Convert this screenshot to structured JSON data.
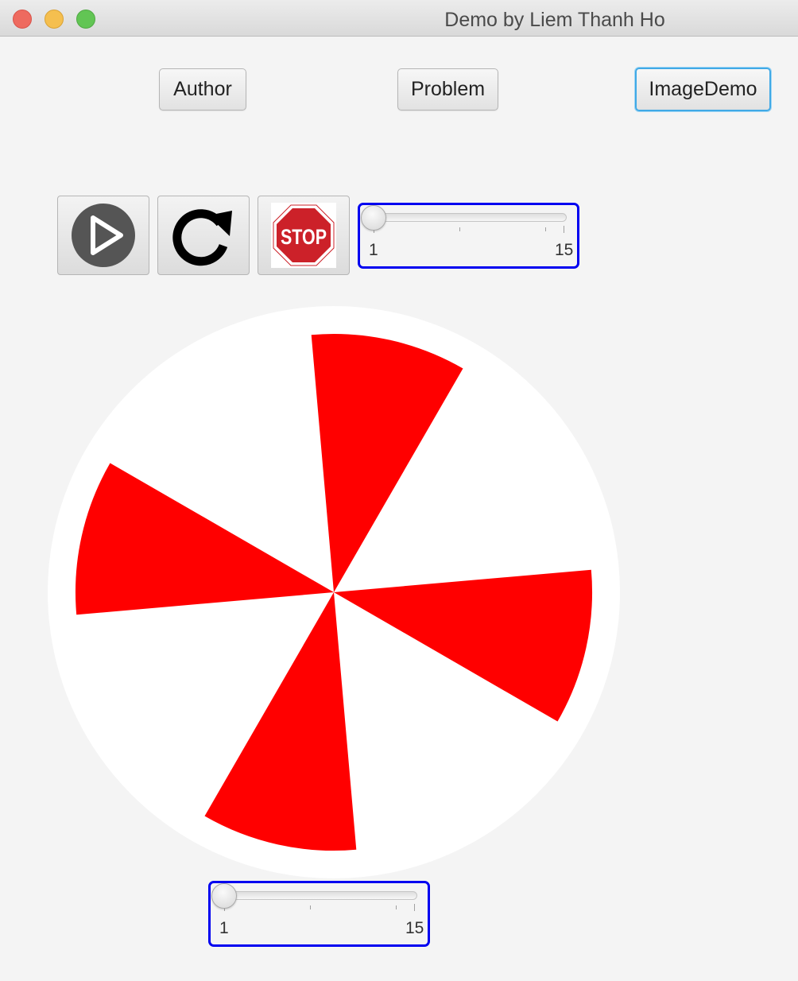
{
  "window": {
    "title": "Demo by Liem Thanh Ho"
  },
  "nav": {
    "author_label": "Author",
    "problem_label": "Problem",
    "imagedemo_label": "ImageDemo"
  },
  "controls": {
    "play_icon": "play-icon",
    "replay_icon": "replay-icon",
    "stop_icon": "stop-sign-icon",
    "stop_text": "STOP"
  },
  "top_slider": {
    "min": 1,
    "max": 15,
    "value": 1,
    "min_label": "1",
    "max_label": "15"
  },
  "bottom_slider": {
    "min": 1,
    "max": 15,
    "value": 1,
    "min_label": "1",
    "max_label": "15"
  },
  "fan": {
    "blades": 4,
    "blade_color": "#ff0000",
    "background_color": "#ffffff"
  },
  "colors": {
    "focus_accent": "#40a9e6",
    "slider_border": "#0000f0",
    "stop_red": "#cc2129"
  }
}
